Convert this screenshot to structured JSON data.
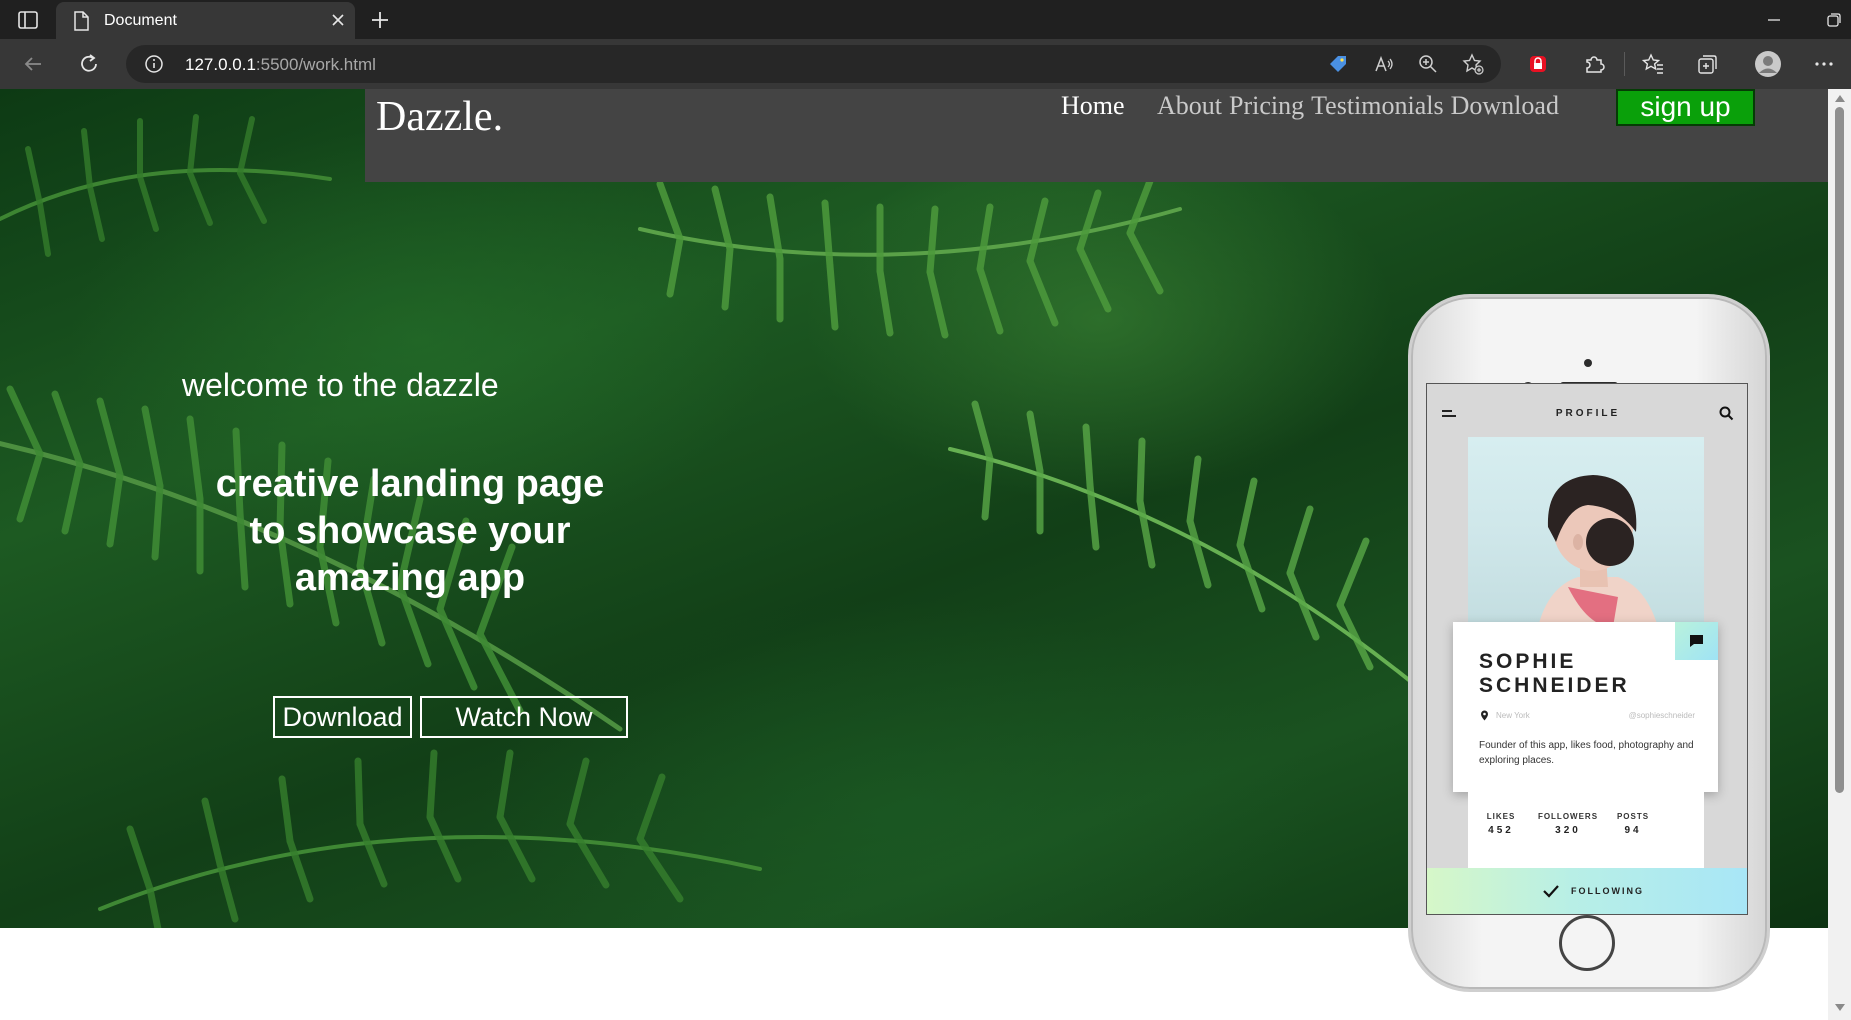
{
  "browser": {
    "tab_title": "Document",
    "url_host": "127.0.0.1",
    "url_rest": ":5500/work.html",
    "icons": [
      "sidebar-icon",
      "document-icon",
      "close-icon",
      "plus-icon",
      "minimize-icon",
      "restore-icon",
      "back-icon",
      "refresh-icon",
      "info-icon",
      "tag-icon",
      "read-aloud-icon",
      "zoom-icon",
      "add-favorite-icon",
      "lock-extension-icon",
      "extensions-icon",
      "favorites-icon",
      "collections-icon",
      "profile-icon",
      "more-icon"
    ]
  },
  "nav": {
    "brand": "Dazzle.",
    "home": "Home",
    "links": [
      "About",
      "Pricing",
      "Testimonials",
      "Download"
    ],
    "signup": "sign up"
  },
  "hero": {
    "welcome": "welcome to the dazzle",
    "headline_lines": [
      "creative landing page",
      "to showcase your",
      "amazing app"
    ],
    "download_button": "Download",
    "watch_button": "Watch Now"
  },
  "phone": {
    "screen_title": "PROFILE",
    "name_lines": [
      "SOPHIE",
      "SCHNEIDER"
    ],
    "location": "New York",
    "handle": "@sophieschneider",
    "bio": "Founder of this app, likes food, photography and exploring places.",
    "stats": [
      {
        "label": "LIKES",
        "value": "452"
      },
      {
        "label": "FOLLOWERS",
        "value": "320"
      },
      {
        "label": "POSTS",
        "value": "94"
      }
    ],
    "following_label": "FOLLOWING"
  },
  "colors": {
    "signup_bg": "#0aa00a",
    "navbar_bg": "#444444",
    "chrome_bg": "#202020"
  }
}
